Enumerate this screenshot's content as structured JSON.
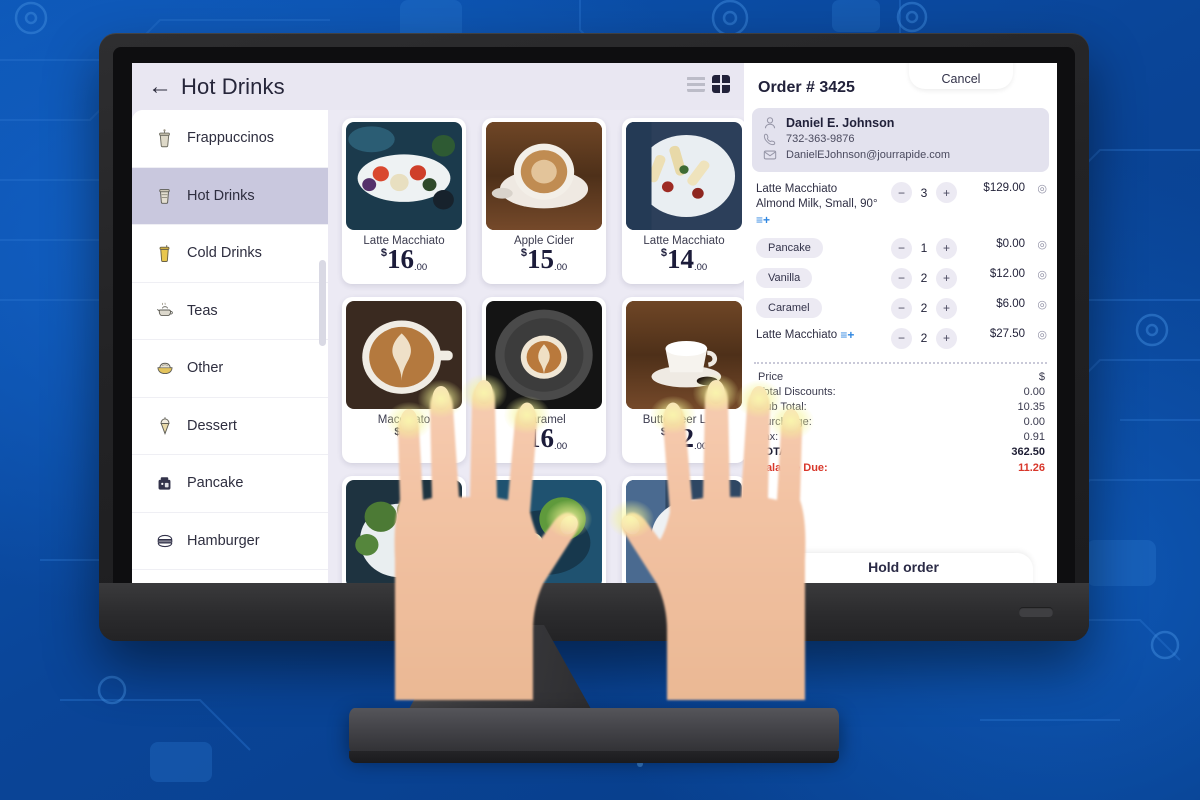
{
  "header": {
    "back_icon": "back-arrow-icon",
    "title": "Hot Drinks",
    "view_list_icon": "list-view-icon",
    "view_grid_icon": "grid-view-icon"
  },
  "sidebar": {
    "items": [
      {
        "label": "Frappuccinos",
        "icon": "frappuccino-cup-icon",
        "active": false
      },
      {
        "label": "Hot Drinks",
        "icon": "hot-cup-icon",
        "active": true
      },
      {
        "label": "Cold Drinks",
        "icon": "cold-glass-icon",
        "active": false
      },
      {
        "label": "Teas",
        "icon": "teapot-icon",
        "active": false
      },
      {
        "label": "Other",
        "icon": "bowl-icon",
        "active": false
      },
      {
        "label": "Dessert",
        "icon": "ice-cream-icon",
        "active": false
      },
      {
        "label": "Pancake",
        "icon": "pancake-icon",
        "active": false
      },
      {
        "label": "Hamburger",
        "icon": "hamburger-icon",
        "active": false
      }
    ]
  },
  "products": [
    {
      "name": "Latte Macchiato",
      "currency": "$",
      "price": "16",
      "decimals": ".00",
      "image": "mezze-platter-photo"
    },
    {
      "name": "Apple Cider",
      "currency": "$",
      "price": "15",
      "decimals": ".00",
      "image": "latte-cup-photo"
    },
    {
      "name": "Latte Macchiato",
      "currency": "$",
      "price": "14",
      "decimals": ".00",
      "image": "pasta-salad-photo"
    },
    {
      "name": "Macchiato",
      "currency": "$",
      "price": "",
      "decimals": ".00",
      "image": "latte-art-photo"
    },
    {
      "name": "Caramel",
      "currency": "$",
      "price": "16",
      "decimals": ".00",
      "image": "caramel-latte-photo"
    },
    {
      "name": "Butterbeer Latte",
      "currency": "$",
      "price": "12",
      "decimals": ".00",
      "image": "espresso-cup-photo"
    },
    {
      "name": "",
      "currency": "",
      "price": "",
      "decimals": "",
      "image": "salad-plate-photo"
    },
    {
      "name": "",
      "currency": "",
      "price": "",
      "decimals": "",
      "image": "green-dish-photo"
    },
    {
      "name": "",
      "currency": "",
      "price": "",
      "decimals": "",
      "image": "taco-plate-photo"
    }
  ],
  "order": {
    "cancel_label": "Cancel",
    "title": "Order # 3425",
    "customer": {
      "name": "Daniel E. Johnson",
      "phone": "732-363-9876",
      "email": "DanielEJohnson@jourrapide.com",
      "person_icon": "person-icon",
      "phone_icon": "phone-icon",
      "mail_icon": "mail-icon"
    },
    "line_items": [
      {
        "label": "Latte Macchiato",
        "sub": "Almond Milk, Small, 90°",
        "has_mod_icon": true,
        "is_chip": false,
        "qty": "3",
        "price": "$129.00"
      },
      {
        "label": "Pancake",
        "sub": "",
        "has_mod_icon": false,
        "is_chip": true,
        "qty": "1",
        "price": "$0.00"
      },
      {
        "label": "Vanilla",
        "sub": "",
        "has_mod_icon": false,
        "is_chip": true,
        "qty": "2",
        "price": "$12.00"
      },
      {
        "label": "Caramel",
        "sub": "",
        "has_mod_icon": false,
        "is_chip": true,
        "qty": "2",
        "price": "$6.00"
      },
      {
        "label": "Latte Macchiato",
        "sub": "",
        "has_mod_icon": true,
        "is_chip": false,
        "qty": "2",
        "price": "$27.50"
      }
    ],
    "qty_minus_label": "−",
    "qty_plus_label": "+",
    "remove_icon": "remove-item-icon",
    "totals": [
      {
        "label": "Price",
        "value": "$",
        "style": "normal"
      },
      {
        "label": "Total Discounts:",
        "value": "0.00",
        "style": "normal"
      },
      {
        "label": "Sub Total:",
        "value": "10.35",
        "style": "normal"
      },
      {
        "label": "Surcharge:",
        "value": "0.00",
        "style": "normal"
      },
      {
        "label": "Tax:",
        "value": "0.91",
        "style": "normal"
      },
      {
        "label": "TOTAL:",
        "value": "362.50",
        "style": "bold"
      },
      {
        "label": "Balance Due:",
        "value": "11.26",
        "style": "due"
      }
    ],
    "hold_label": "Hold order"
  },
  "colors": {
    "background_blue": "#0b4ea2",
    "bezel_dark": "#232325",
    "sidebar_active": "#c9c8de",
    "accent_blue": "#2f86e0",
    "due_red": "#d8372b",
    "panel_lavender": "#e3e2ee"
  }
}
